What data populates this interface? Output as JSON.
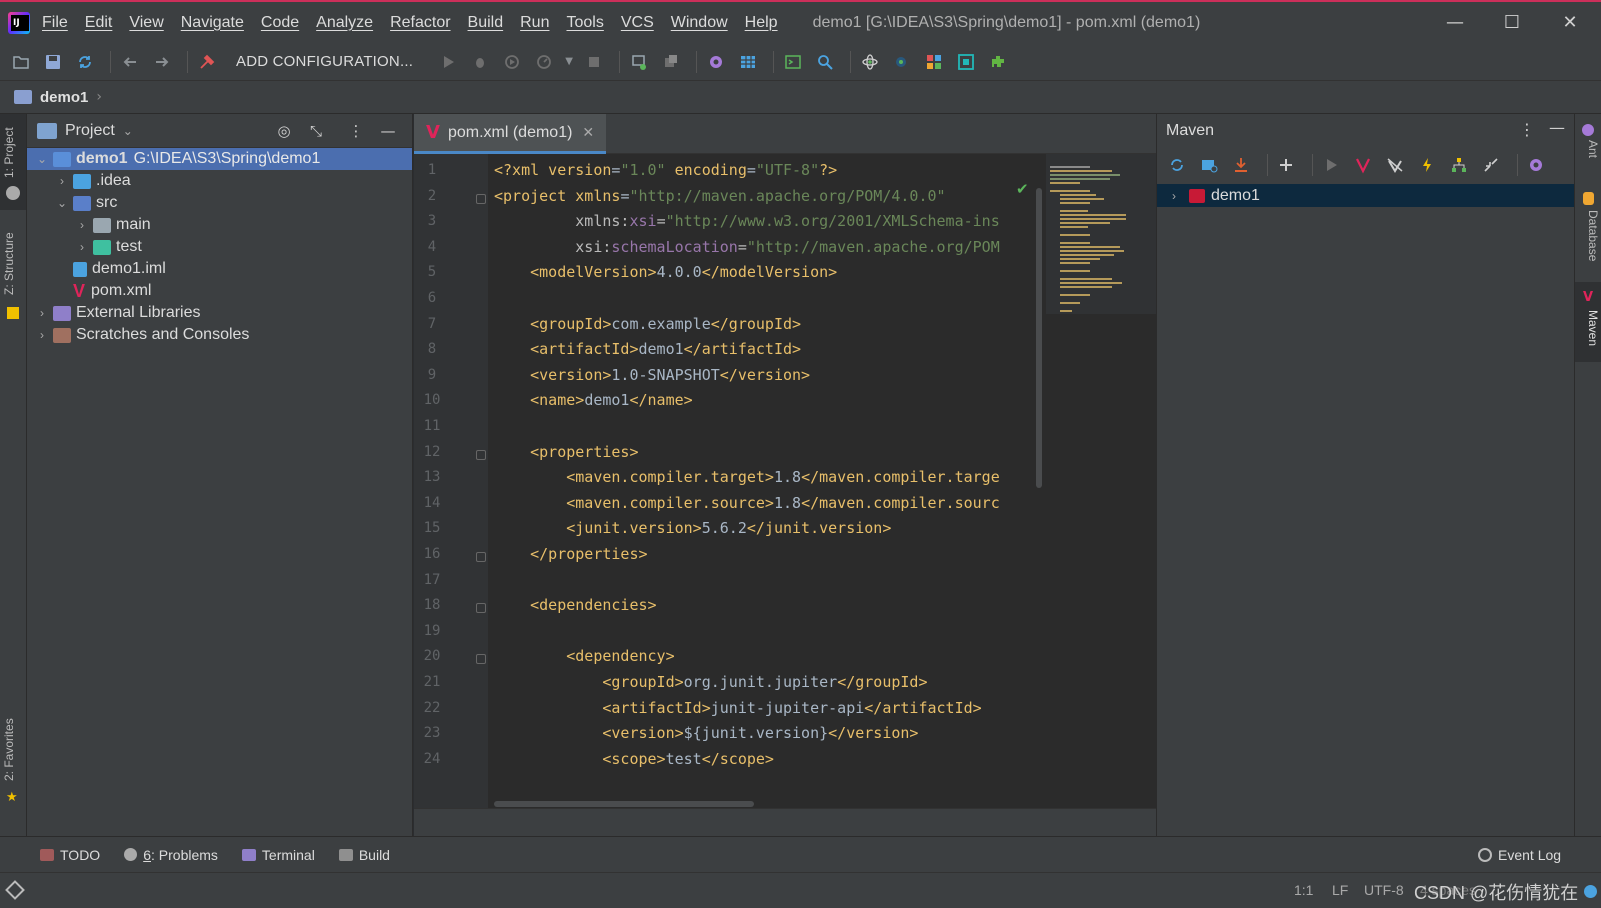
{
  "menu": [
    "File",
    "Edit",
    "View",
    "Navigate",
    "Code",
    "Analyze",
    "Refactor",
    "Build",
    "Run",
    "Tools",
    "VCS",
    "Window",
    "Help"
  ],
  "window_title": "demo1 [G:\\IDEA\\S3\\Spring\\demo1] - pom.xml (demo1)",
  "window_controls": {
    "minimize": "—",
    "maximize": "☐",
    "close": "✕"
  },
  "toolbar": {
    "add_config_label": "ADD CONFIGURATION..."
  },
  "breadcrumb": {
    "label": "demo1"
  },
  "left_stripe": {
    "project_tab": "1: Project",
    "structure_tab": "Z: Structure",
    "favorites_tab": "2: Favorites"
  },
  "right_stripe": {
    "ant_tab": "Ant",
    "database_tab": "Database",
    "maven_tab": "Maven"
  },
  "project_panel": {
    "title": "Project",
    "tree": [
      {
        "label": "demo1",
        "path": "G:\\IDEA\\S3\\Spring\\demo1",
        "expanded": true,
        "selected": true
      },
      {
        "label": ".idea",
        "expanded": false
      },
      {
        "label": "src",
        "expanded": true
      },
      {
        "label": "main",
        "expanded": false
      },
      {
        "label": "test",
        "expanded": false
      },
      {
        "label": "demo1.iml"
      },
      {
        "label": "pom.xml"
      },
      {
        "label": "External Libraries",
        "expanded": false
      },
      {
        "label": "Scratches and Consoles",
        "expanded": false
      }
    ]
  },
  "editor": {
    "tab_label": "pom.xml (demo1)",
    "line_numbers": [
      "1",
      "2",
      "3",
      "4",
      "5",
      "6",
      "7",
      "8",
      "9",
      "10",
      "11",
      "12",
      "13",
      "14",
      "15",
      "16",
      "17",
      "18",
      "19",
      "20",
      "21",
      "22",
      "23",
      "24"
    ],
    "lines": [
      "<?xml version=\"1.0\" encoding=\"UTF-8\"?>",
      "<project xmlns=\"http://maven.apache.org/POM/4.0.0\"",
      "         xmlns:xsi=\"http://www.w3.org/2001/XMLSchema-ins",
      "         xsi:schemaLocation=\"http://maven.apache.org/POM",
      "    <modelVersion>4.0.0</modelVersion>",
      "",
      "    <groupId>com.example</groupId>",
      "    <artifactId>demo1</artifactId>",
      "    <version>1.0-SNAPSHOT</version>",
      "    <name>demo1</name>",
      "",
      "    <properties>",
      "        <maven.compiler.target>1.8</maven.compiler.targe",
      "        <maven.compiler.source>1.8</maven.compiler.sourc",
      "        <junit.version>5.6.2</junit.version>",
      "    </properties>",
      "",
      "    <dependencies>",
      "",
      "        <dependency>",
      "            <groupId>org.junit.jupiter</groupId>",
      "            <artifactId>junit-jupiter-api</artifactId>",
      "            <version>${junit.version}</version>",
      "            <scope>test</scope>"
    ]
  },
  "maven_panel": {
    "title": "Maven",
    "root_item": "demo1"
  },
  "bottom_tools": {
    "todo": "TODO",
    "problems_num": "6",
    "problems": ": Problems",
    "terminal": "Terminal",
    "build": "Build",
    "event_log": "Event Log"
  },
  "status": {
    "position": "1:1",
    "line_sep": "LF",
    "encoding": "UTF-8",
    "indent": "4 spaces",
    "watermark": "CSDN @花伤情犹在"
  },
  "colors": {
    "accent": "#4b6eaf",
    "maven_brand": "#c71a36",
    "xml_tag": "#e8bf6a",
    "xml_string": "#6a8759"
  }
}
